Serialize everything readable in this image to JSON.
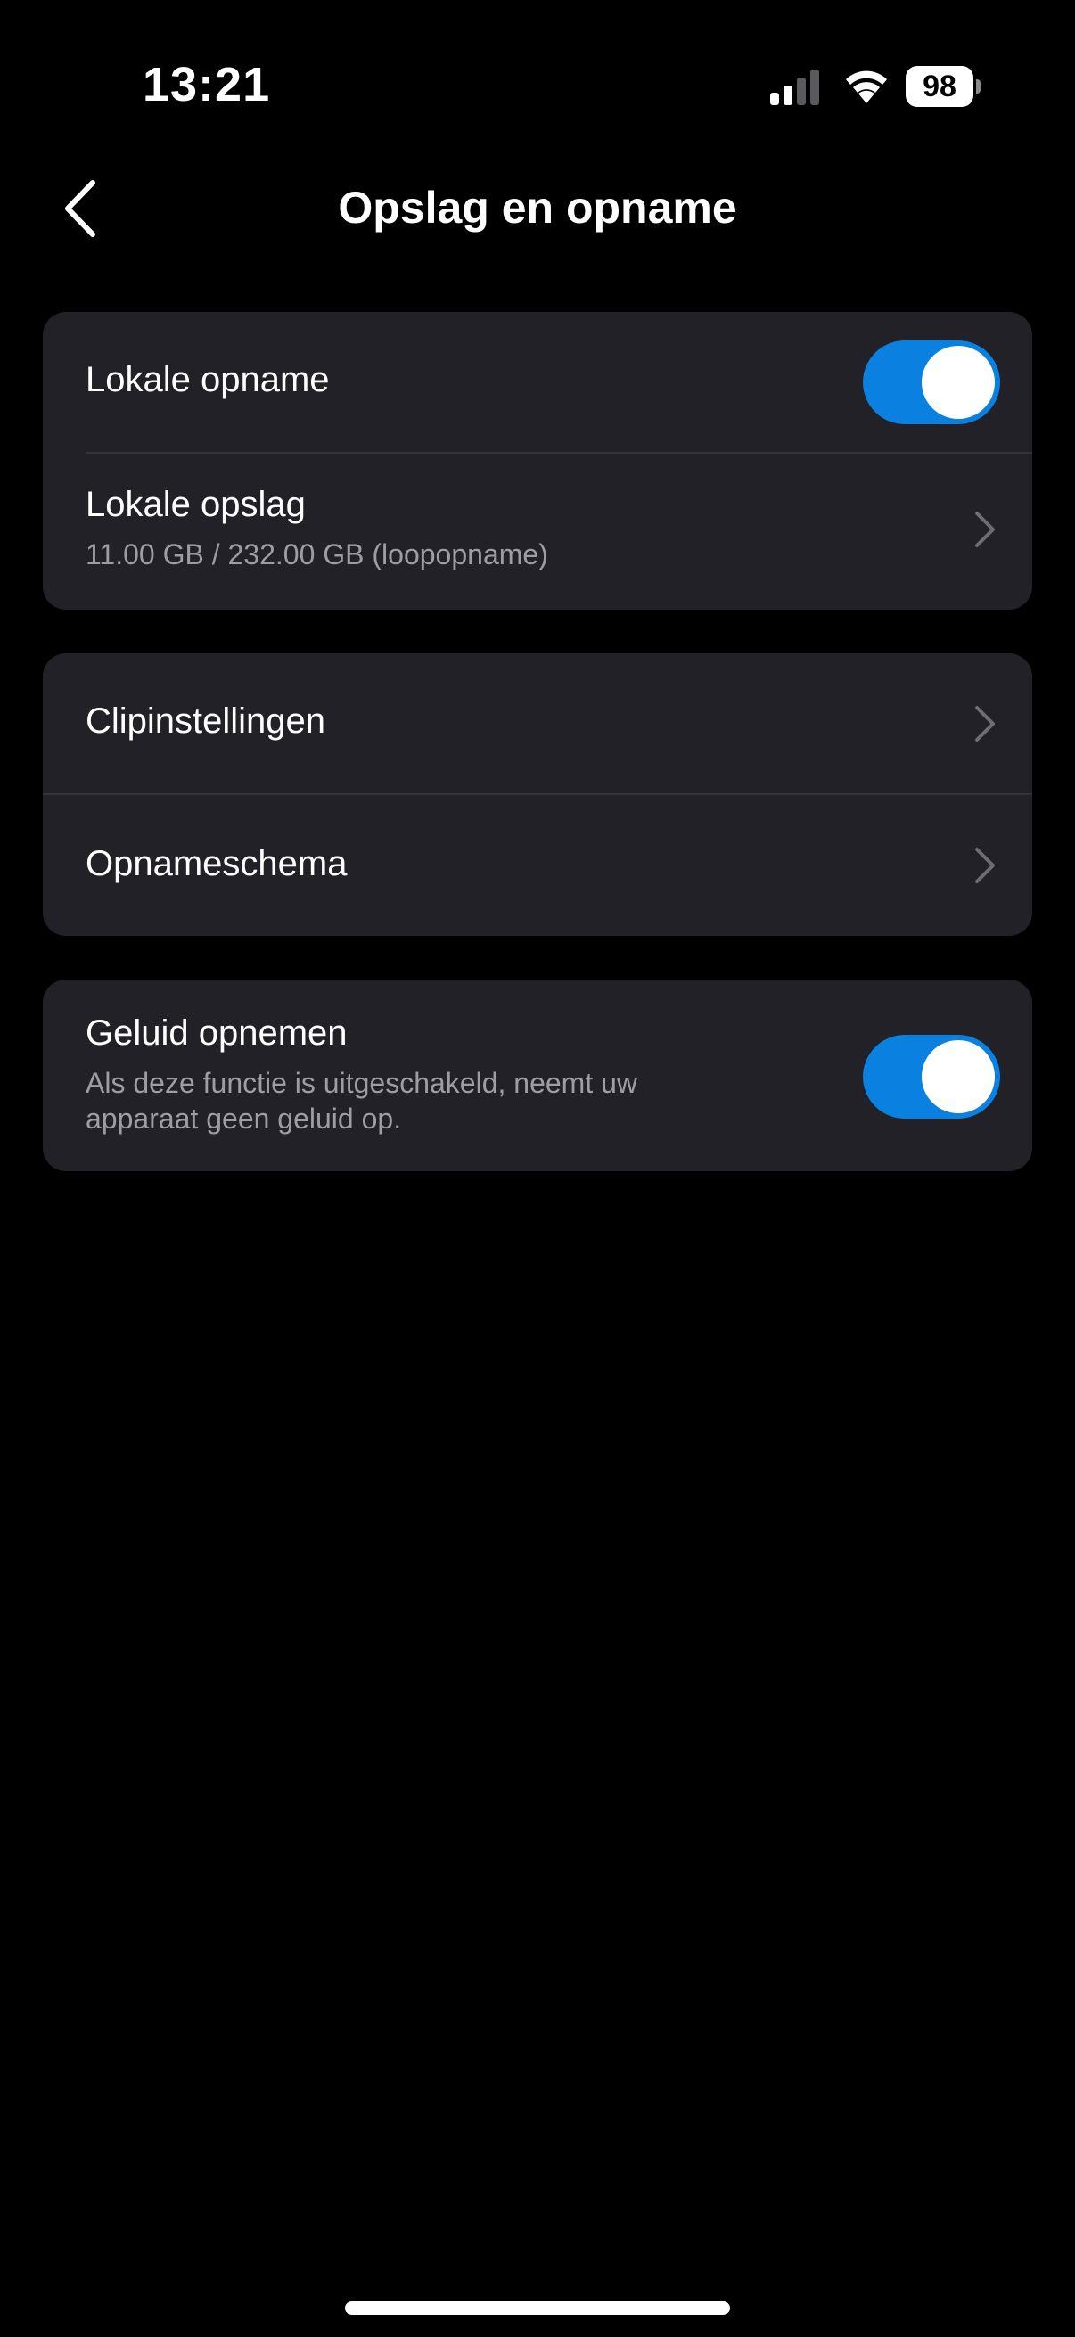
{
  "status_bar": {
    "time": "13:21",
    "battery_level": "98",
    "icons": [
      "signal-icon",
      "wifi-icon",
      "battery-icon"
    ]
  },
  "nav": {
    "title": "Opslag en opname",
    "back_icon": "chevron-left-icon"
  },
  "sections": [
    {
      "rows": [
        {
          "label": "Lokale opname",
          "control": "toggle",
          "on": true
        },
        {
          "label": "Lokale opslag",
          "sublabel": "11.00 GB / 232.00 GB (loopopname)",
          "control": "chevron"
        }
      ]
    },
    {
      "rows": [
        {
          "label": "Clipinstellingen",
          "control": "chevron"
        },
        {
          "label": "Opnameschema",
          "control": "chevron"
        }
      ]
    },
    {
      "rows": [
        {
          "label": "Geluid opnemen",
          "sublabel_line1": "Als deze functie is uitgeschakeld, neemt uw",
          "sublabel_line2": "apparaat geen geluid op.",
          "control": "toggle",
          "on": true
        }
      ]
    }
  ],
  "colors": {
    "background": "#000000",
    "card": "#212127",
    "accent": "#0a80e0",
    "secondary_text": "#9d9da3"
  }
}
